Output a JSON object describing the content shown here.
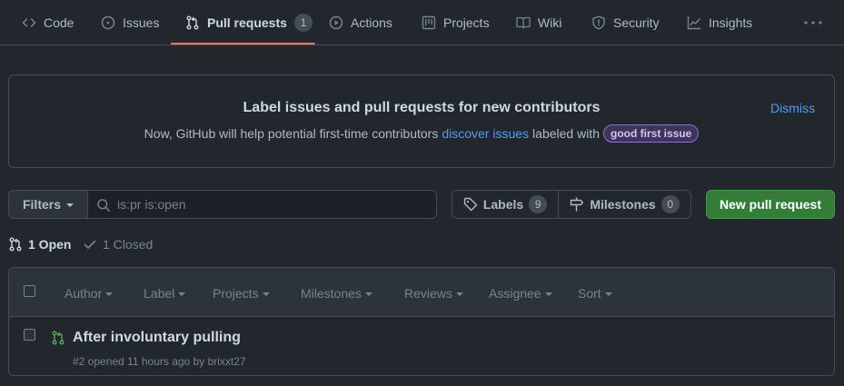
{
  "nav": {
    "tabs": [
      {
        "label": "Code",
        "icon": "code-icon"
      },
      {
        "label": "Issues",
        "icon": "issue-opened-icon"
      },
      {
        "label": "Pull requests",
        "icon": "git-pull-request-icon",
        "count": "1",
        "selected": true
      },
      {
        "label": "Actions",
        "icon": "play-icon"
      },
      {
        "label": "Projects",
        "icon": "project-icon"
      },
      {
        "label": "Wiki",
        "icon": "book-icon"
      },
      {
        "label": "Security",
        "icon": "shield-icon"
      },
      {
        "label": "Insights",
        "icon": "graph-icon"
      }
    ],
    "more_icon": "kebab-horizontal-icon"
  },
  "banner": {
    "title": "Label issues and pull requests for new contributors",
    "text_before": "Now, GitHub will help potential first-time contributors",
    "link": "discover issues",
    "text_after": "labeled with",
    "label": "good first issue",
    "dismiss": "Dismiss"
  },
  "filterbar": {
    "filters_label": "Filters",
    "search_value": "is:pr is:open",
    "labels_label": "Labels",
    "labels_count": "9",
    "milestones_label": "Milestones",
    "milestones_count": "0",
    "new_pr_label": "New pull request"
  },
  "states": {
    "open_label": "1 Open",
    "closed_label": "1 Closed"
  },
  "list": {
    "header_filters": [
      "Author",
      "Label",
      "Projects",
      "Milestones",
      "Reviews",
      "Assignee",
      "Sort"
    ],
    "items": [
      {
        "title": "After involuntary pulling",
        "meta_prefix": "#2 opened 11 hours ago by",
        "author": "brixxt27"
      }
    ]
  },
  "colors": {
    "background": "#22272e",
    "accent_underline": "#ec775c",
    "link": "#539bf5",
    "primary_button": "#347d39",
    "open_pr_icon": "#57ab5a",
    "good_first_issue_label": "#8b73c9"
  }
}
